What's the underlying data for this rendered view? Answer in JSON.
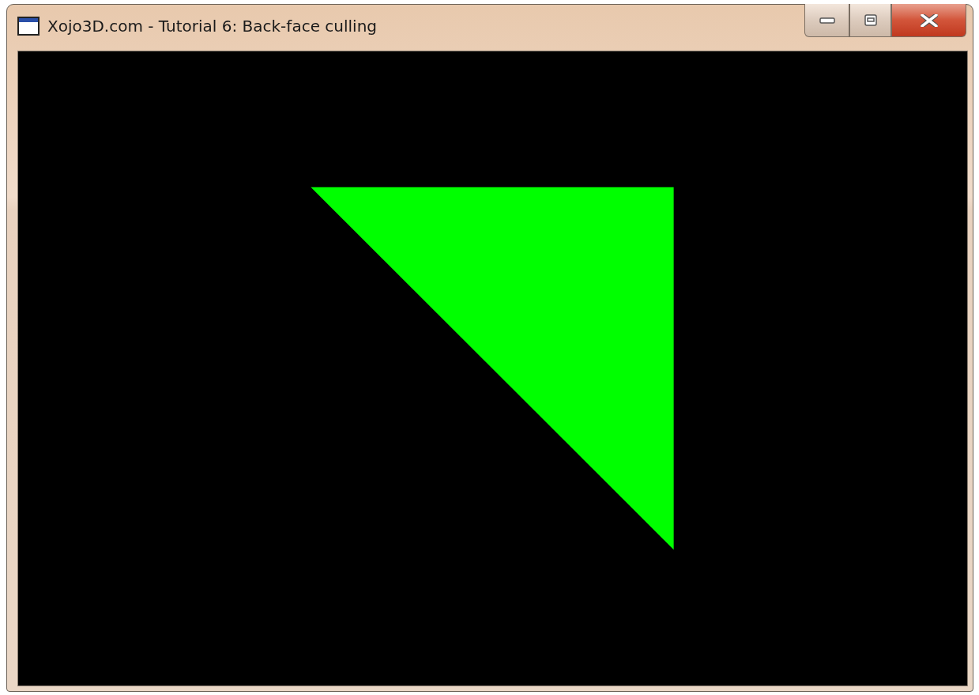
{
  "window": {
    "title": "Xojo3D.com - Tutorial 6: Back-face culling"
  }
}
